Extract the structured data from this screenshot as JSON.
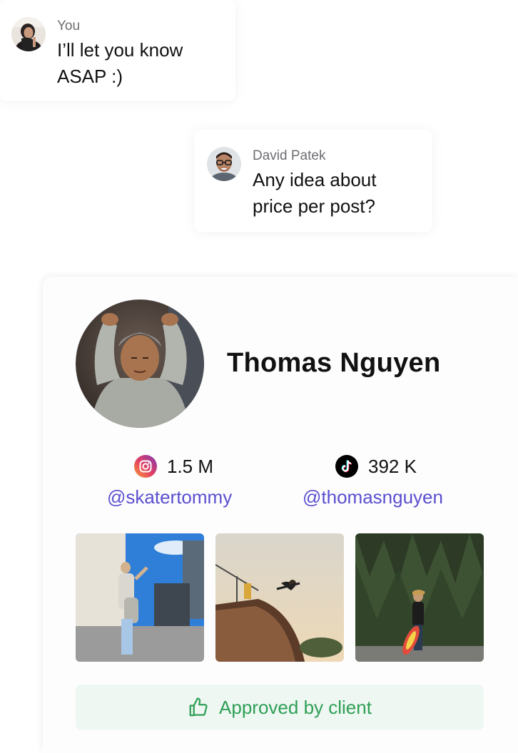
{
  "messages": [
    {
      "sender": "You",
      "text": "I’ll let you know ASAP :)",
      "avatar": "avatar-you"
    },
    {
      "sender": "David Patek",
      "text": "Any idea about price per post?",
      "avatar": "avatar-david"
    }
  ],
  "profile": {
    "name": "Thomas Nguyen",
    "instagram": {
      "followers": "1.5 M",
      "handle": "@skatertommy",
      "icon": "instagram-icon"
    },
    "tiktok": {
      "followers": "392 K",
      "handle": "@thomasnguyen",
      "icon": "tiktok-icon"
    },
    "approved_label": "Approved by client",
    "approved_icon": "thumbs-up-icon"
  },
  "colors": {
    "handle": "#5b4fcf",
    "approved_text": "#2e9f57",
    "approved_bg": "#eef7f1"
  }
}
